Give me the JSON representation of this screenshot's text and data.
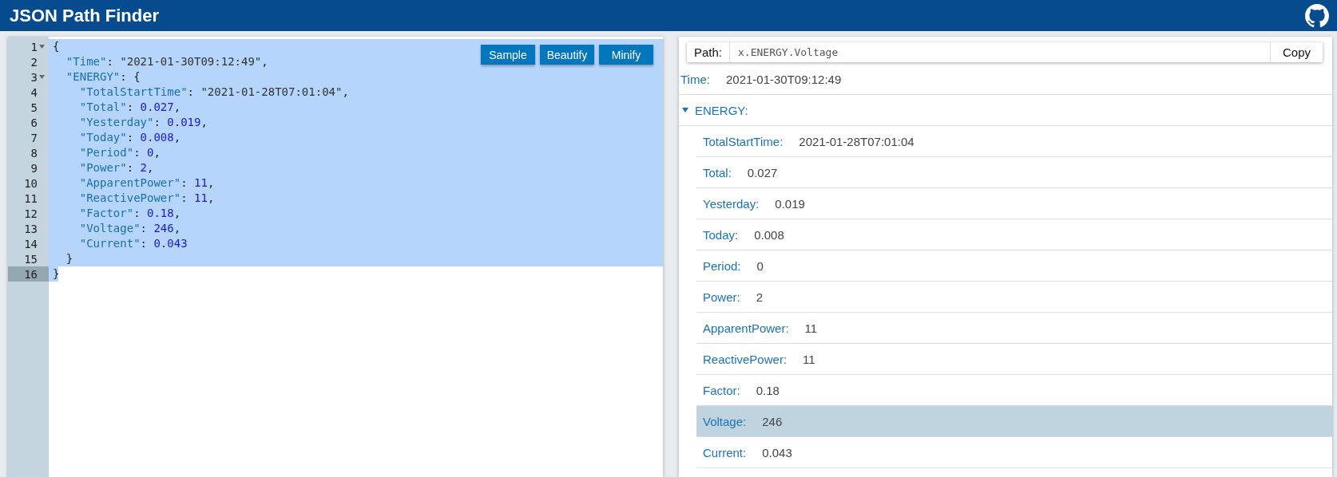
{
  "header": {
    "title": "JSON Path Finder"
  },
  "toolbar": {
    "buttons": [
      "Sample",
      "Beautify",
      "Minify"
    ]
  },
  "editor": {
    "lines": [
      {
        "number": "1",
        "fold": true,
        "selected": true,
        "active": false,
        "tokens": [
          {
            "kind": "punct",
            "text": "{"
          }
        ]
      },
      {
        "number": "2",
        "fold": false,
        "selected": true,
        "active": false,
        "tokens": [
          {
            "kind": "key",
            "text": "  \"Time\""
          },
          {
            "kind": "punct",
            "text": ": "
          },
          {
            "kind": "string",
            "text": "\"2021-01-30T09:12:49\""
          },
          {
            "kind": "punct",
            "text": ","
          }
        ]
      },
      {
        "number": "3",
        "fold": true,
        "selected": true,
        "active": false,
        "tokens": [
          {
            "kind": "key",
            "text": "  \"ENERGY\""
          },
          {
            "kind": "punct",
            "text": ": {"
          }
        ]
      },
      {
        "number": "4",
        "fold": false,
        "selected": true,
        "active": false,
        "tokens": [
          {
            "kind": "key",
            "text": "    \"TotalStartTime\""
          },
          {
            "kind": "punct",
            "text": ": "
          },
          {
            "kind": "string",
            "text": "\"2021-01-28T07:01:04\""
          },
          {
            "kind": "punct",
            "text": ","
          }
        ]
      },
      {
        "number": "5",
        "fold": false,
        "selected": true,
        "active": false,
        "tokens": [
          {
            "kind": "key",
            "text": "    \"Total\""
          },
          {
            "kind": "punct",
            "text": ": "
          },
          {
            "kind": "number",
            "text": "0.027"
          },
          {
            "kind": "punct",
            "text": ","
          }
        ]
      },
      {
        "number": "6",
        "fold": false,
        "selected": true,
        "active": false,
        "tokens": [
          {
            "kind": "key",
            "text": "    \"Yesterday\""
          },
          {
            "kind": "punct",
            "text": ": "
          },
          {
            "kind": "number",
            "text": "0.019"
          },
          {
            "kind": "punct",
            "text": ","
          }
        ]
      },
      {
        "number": "7",
        "fold": false,
        "selected": true,
        "active": false,
        "tokens": [
          {
            "kind": "key",
            "text": "    \"Today\""
          },
          {
            "kind": "punct",
            "text": ": "
          },
          {
            "kind": "number",
            "text": "0.008"
          },
          {
            "kind": "punct",
            "text": ","
          }
        ]
      },
      {
        "number": "8",
        "fold": false,
        "selected": true,
        "active": false,
        "tokens": [
          {
            "kind": "key",
            "text": "    \"Period\""
          },
          {
            "kind": "punct",
            "text": ": "
          },
          {
            "kind": "number",
            "text": "0"
          },
          {
            "kind": "punct",
            "text": ","
          }
        ]
      },
      {
        "number": "9",
        "fold": false,
        "selected": true,
        "active": false,
        "tokens": [
          {
            "kind": "key",
            "text": "    \"Power\""
          },
          {
            "kind": "punct",
            "text": ": "
          },
          {
            "kind": "number",
            "text": "2"
          },
          {
            "kind": "punct",
            "text": ","
          }
        ]
      },
      {
        "number": "10",
        "fold": false,
        "selected": true,
        "active": false,
        "tokens": [
          {
            "kind": "key",
            "text": "    \"ApparentPower\""
          },
          {
            "kind": "punct",
            "text": ": "
          },
          {
            "kind": "number",
            "text": "11"
          },
          {
            "kind": "punct",
            "text": ","
          }
        ]
      },
      {
        "number": "11",
        "fold": false,
        "selected": true,
        "active": false,
        "tokens": [
          {
            "kind": "key",
            "text": "    \"ReactivePower\""
          },
          {
            "kind": "punct",
            "text": ": "
          },
          {
            "kind": "number",
            "text": "11"
          },
          {
            "kind": "punct",
            "text": ","
          }
        ]
      },
      {
        "number": "12",
        "fold": false,
        "selected": true,
        "active": false,
        "tokens": [
          {
            "kind": "key",
            "text": "    \"Factor\""
          },
          {
            "kind": "punct",
            "text": ": "
          },
          {
            "kind": "number",
            "text": "0.18"
          },
          {
            "kind": "punct",
            "text": ","
          }
        ]
      },
      {
        "number": "13",
        "fold": false,
        "selected": true,
        "active": false,
        "tokens": [
          {
            "kind": "key",
            "text": "    \"Voltage\""
          },
          {
            "kind": "punct",
            "text": ": "
          },
          {
            "kind": "number",
            "text": "246"
          },
          {
            "kind": "punct",
            "text": ","
          }
        ]
      },
      {
        "number": "14",
        "fold": false,
        "selected": true,
        "active": false,
        "tokens": [
          {
            "kind": "key",
            "text": "    \"Current\""
          },
          {
            "kind": "punct",
            "text": ": "
          },
          {
            "kind": "number",
            "text": "0.043"
          }
        ]
      },
      {
        "number": "15",
        "fold": false,
        "selected": true,
        "active": false,
        "tokens": [
          {
            "kind": "punct",
            "text": "  }"
          }
        ]
      },
      {
        "number": "16",
        "fold": false,
        "selected": false,
        "active": true,
        "tokens": [
          {
            "kind": "punct",
            "text": "}"
          }
        ]
      }
    ]
  },
  "path_bar": {
    "label": "Path:",
    "value": "x.ENERGY.Voltage",
    "button": "Copy"
  },
  "tree": {
    "items": [
      {
        "key": "Time:",
        "value": "2021-01-30T09:12:49",
        "selected": false
      },
      {
        "key": "ENERGY:",
        "expanded": true,
        "selected": false,
        "children": [
          {
            "key": "TotalStartTime:",
            "value": "2021-01-28T07:01:04",
            "selected": false
          },
          {
            "key": "Total:",
            "value": "0.027",
            "selected": false
          },
          {
            "key": "Yesterday:",
            "value": "0.019",
            "selected": false
          },
          {
            "key": "Today:",
            "value": "0.008",
            "selected": false
          },
          {
            "key": "Period:",
            "value": "0",
            "selected": false
          },
          {
            "key": "Power:",
            "value": "2",
            "selected": false
          },
          {
            "key": "ApparentPower:",
            "value": "11",
            "selected": false
          },
          {
            "key": "ReactivePower:",
            "value": "11",
            "selected": false
          },
          {
            "key": "Factor:",
            "value": "0.18",
            "selected": false
          },
          {
            "key": "Voltage:",
            "value": "246",
            "selected": true
          },
          {
            "key": "Current:",
            "value": "0.043",
            "selected": false
          }
        ]
      }
    ]
  }
}
